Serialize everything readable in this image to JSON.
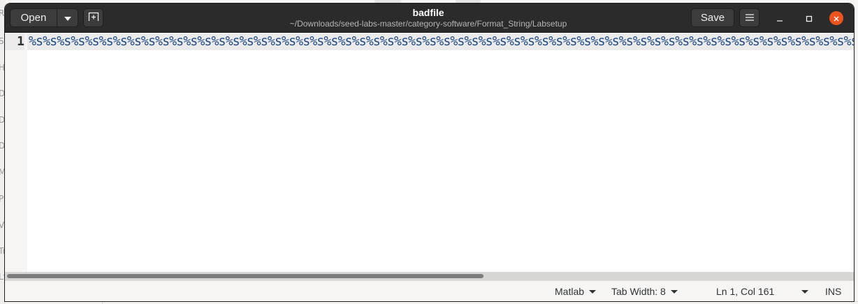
{
  "window": {
    "title": "badfile",
    "subtitle": "~/Downloads/seed-labs-master/category-software/Format_String/Labsetup"
  },
  "headerbar": {
    "open_label": "Open",
    "save_label": "Save"
  },
  "editor": {
    "line_number": "1",
    "line_text": "%s%s%s%s%s%s%s%s%s%s%s%s%s%s%s%s%s%s%s%s%s%s%s%s%s%s%s%s%s%s%s%s%s%s%s%s%s%s%s%s%s%s%s%s%s%s%s%s%s%s%s%s%s%s%s%s%s%s%s%s%s%s%s%s"
  },
  "statusbar": {
    "language": "Matlab",
    "tab_width": "Tab Width: 8",
    "position": "Ln 1, Col 161",
    "mode": "INS"
  },
  "colors": {
    "headerbar_bg": "#2b2b2b",
    "close_button": "#e95420",
    "code_text": "#204a87"
  },
  "icons": [
    "chevron-down-icon",
    "new-tab-icon",
    "hamburger-menu-icon",
    "minimize-icon",
    "maximize-icon",
    "close-icon"
  ]
}
